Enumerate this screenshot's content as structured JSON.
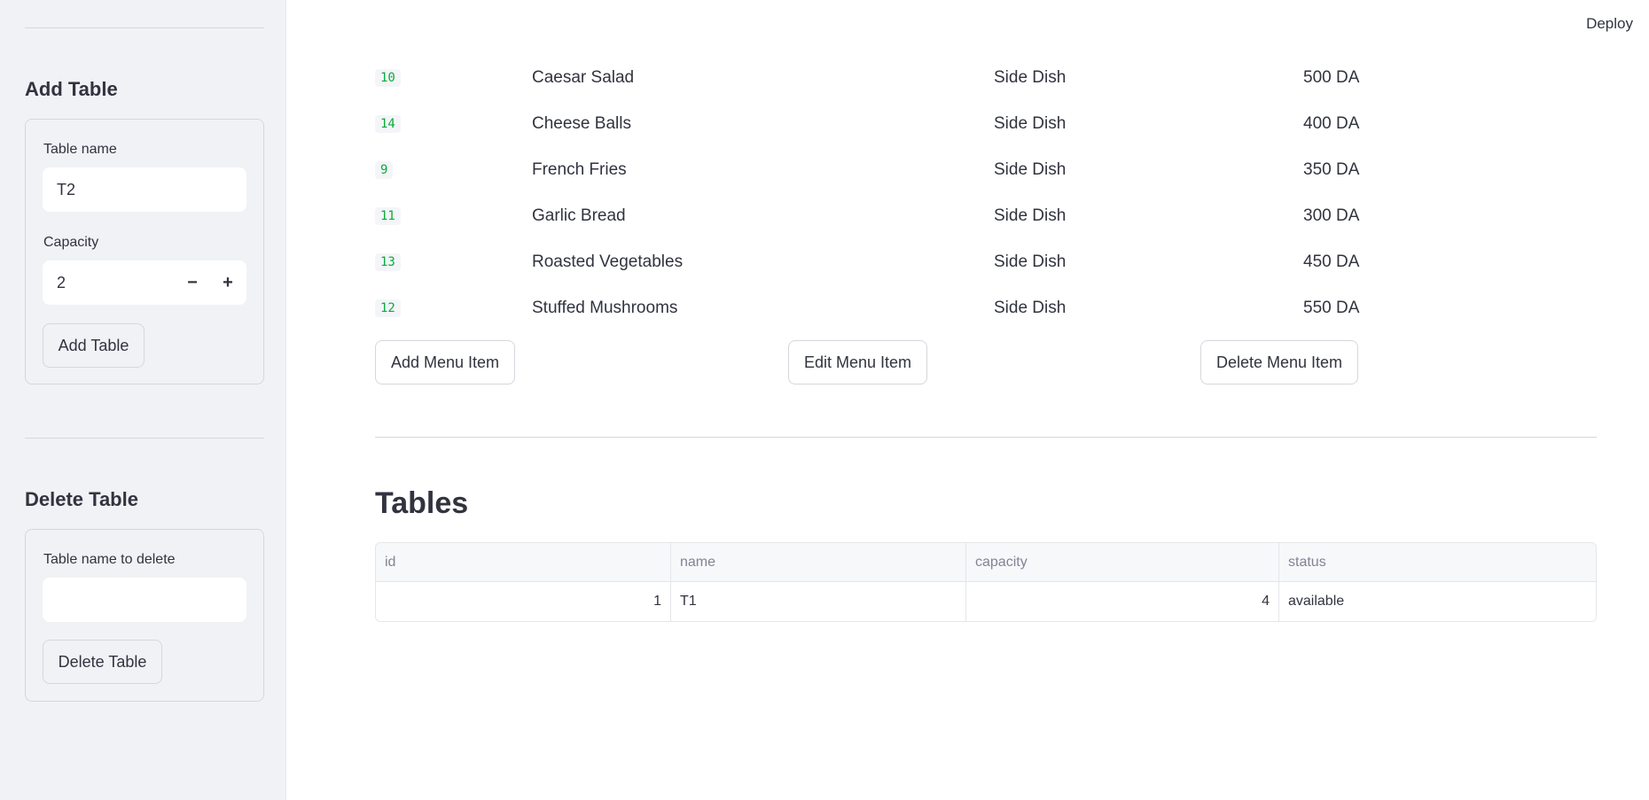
{
  "header": {
    "deploy_label": "Deploy"
  },
  "sidebar": {
    "add_table": {
      "heading": "Add Table",
      "name_label": "Table name",
      "name_value": "T2",
      "capacity_label": "Capacity",
      "capacity_value": "2",
      "decrement_label": "−",
      "increment_label": "+",
      "button_label": "Add Table"
    },
    "delete_table": {
      "heading": "Delete Table",
      "name_label": "Table name to delete",
      "name_value": "",
      "button_label": "Delete Table"
    }
  },
  "menu": {
    "rows": [
      {
        "id": "10",
        "name": "Caesar Salad",
        "category": "Side Dish",
        "price": "500 DA"
      },
      {
        "id": "14",
        "name": "Cheese Balls",
        "category": "Side Dish",
        "price": "400 DA"
      },
      {
        "id": "9",
        "name": "French Fries",
        "category": "Side Dish",
        "price": "350 DA"
      },
      {
        "id": "11",
        "name": "Garlic Bread",
        "category": "Side Dish",
        "price": "300 DA"
      },
      {
        "id": "13",
        "name": "Roasted Vegetables",
        "category": "Side Dish",
        "price": "450 DA"
      },
      {
        "id": "12",
        "name": "Stuffed Mushrooms",
        "category": "Side Dish",
        "price": "550 DA"
      }
    ],
    "add_label": "Add Menu Item",
    "edit_label": "Edit Menu Item",
    "delete_label": "Delete Menu Item"
  },
  "tables": {
    "title": "Tables",
    "columns": [
      "id",
      "name",
      "capacity",
      "status"
    ],
    "rows": [
      [
        "1",
        "T1",
        "4",
        "available"
      ]
    ]
  }
}
